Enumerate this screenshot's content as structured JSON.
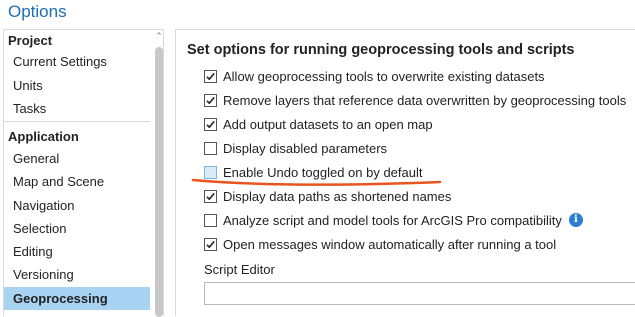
{
  "window": {
    "title": "Options"
  },
  "sidebar": {
    "groups": [
      {
        "label": "Project",
        "items": [
          {
            "label": "Current Settings"
          },
          {
            "label": "Units"
          },
          {
            "label": "Tasks"
          }
        ]
      },
      {
        "label": "Application",
        "items": [
          {
            "label": "General"
          },
          {
            "label": "Map and Scene"
          },
          {
            "label": "Navigation"
          },
          {
            "label": "Selection"
          },
          {
            "label": "Editing"
          },
          {
            "label": "Versioning"
          },
          {
            "label": "Geoprocessing",
            "selected": true
          }
        ]
      }
    ]
  },
  "main": {
    "heading": "Set options for running geoprocessing tools and scripts",
    "options": [
      {
        "label": "Allow geoprocessing tools to overwrite existing datasets",
        "checked": true
      },
      {
        "label": "Remove layers that reference data overwritten by geoprocessing tools",
        "checked": true
      },
      {
        "label": "Add output datasets to an open map",
        "checked": true
      },
      {
        "label": "Display disabled parameters",
        "checked": false
      },
      {
        "label": "Enable Undo toggled on by default",
        "checked": false
      },
      {
        "label": "Display data paths as shortened names",
        "checked": true
      },
      {
        "label": "Analyze script and model tools for ArcGIS Pro compatibility",
        "checked": false,
        "info": "i"
      },
      {
        "label": "Open messages window automatically after running a tool",
        "checked": true
      }
    ],
    "script_editor": {
      "label": "Script Editor",
      "value": ""
    }
  },
  "annotation": {
    "color": "#e8541e"
  },
  "icons": {
    "checkbox_check": "checkmark-icon",
    "info": "info-icon",
    "scroll_up": "chevron-up-icon"
  }
}
